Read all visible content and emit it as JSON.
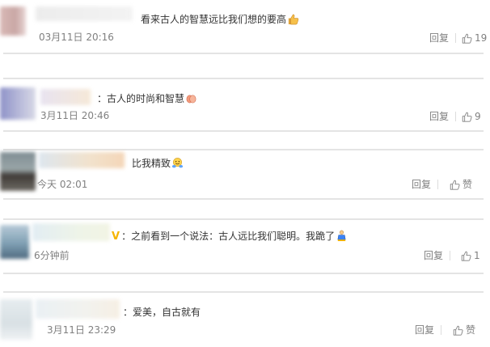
{
  "comments": [
    {
      "text": "看来古人的智慧远比我们想的要高",
      "emoji": "thumbs-up-emoji",
      "time": "03月11日 20:16",
      "reply_label": "回复",
      "like_count": "19"
    },
    {
      "text": "：古人的时尚和智慧",
      "emoji": "clapping-hands-emoji",
      "time": "3月11日 20:46",
      "reply_label": "回复",
      "like_count": "9"
    },
    {
      "text": "比我精致",
      "emoji": "hugging-face-emoji",
      "time": "今天 02:01",
      "reply_label": "回复",
      "like_count": "赞"
    },
    {
      "badge": "V",
      "text": "：之前看到一个说法：古人远比我们聪明。我跪了",
      "emoji": "kneeling-person-emoji",
      "time": "6分钟前",
      "reply_label": "回复",
      "like_count": "1"
    },
    {
      "text": "：爱美，自古就有",
      "time": "3月11日 23:29",
      "reply_label": "回复",
      "like_count": "赞"
    }
  ],
  "colors": {
    "text": "#333333",
    "meta": "#808080",
    "divider": "#e4e4e4",
    "badge": "#f5b400"
  }
}
